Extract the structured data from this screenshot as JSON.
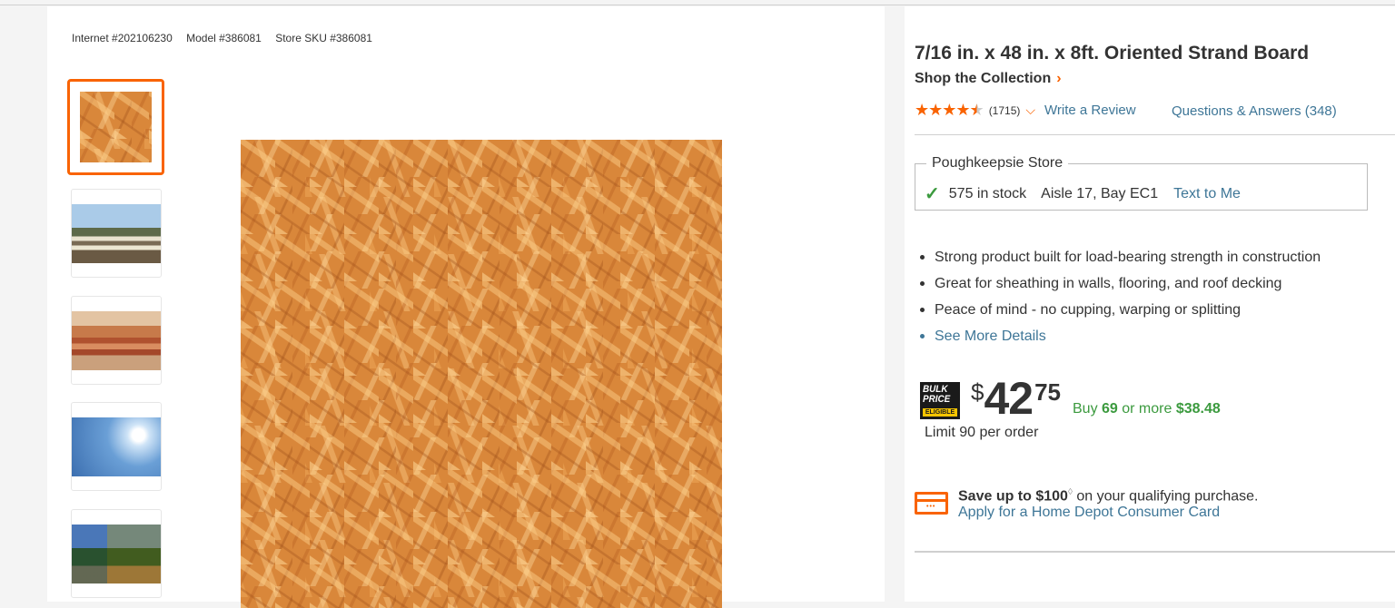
{
  "identifiers": {
    "internet": "Internet #202106230",
    "model": "Model #386081",
    "store_sku": "Store SKU #386081"
  },
  "thumbnails": [
    {
      "icon": "osb-board-image",
      "active": true
    },
    {
      "icon": "roof-construction-image",
      "active": false
    },
    {
      "icon": "board-stack-image",
      "active": false
    },
    {
      "icon": "workers-sky-image",
      "active": false
    },
    {
      "icon": "wall-sheathing-image",
      "active": false
    }
  ],
  "product": {
    "title": "7/16 in. x 48 in. x 8ft. Oriented Strand Board",
    "shop_collection": "Shop the Collection",
    "rating_value": 4.5,
    "review_count": "(1715)",
    "write_review": "Write a Review",
    "qa_link": "Questions & Answers (348)"
  },
  "store": {
    "name": "Poughkeepsie Store",
    "stock": "575 in stock",
    "aisle": "Aisle 17, Bay EC1",
    "text_to_me": "Text to Me"
  },
  "bullets": [
    "Strong product built for load-bearing strength in construction",
    "Great for sheathing in walls, flooring, and roof decking",
    "Peace of mind - no cupping, warping or splitting"
  ],
  "see_more": "See More Details",
  "bulk_badge": {
    "line1": "BULK",
    "line2": "PRICE",
    "line3": "ELIGIBLE"
  },
  "price": {
    "currency": "$",
    "dollars": "42",
    "cents": "75",
    "bulk_prefix": "Buy ",
    "bulk_qty": "69",
    "bulk_mid": " or more ",
    "bulk_price": "$38.48",
    "limit": "Limit 90 per order"
  },
  "credit": {
    "save_bold": "Save up to $100",
    "save_mark": "◊",
    "save_rest": " on your qualifying purchase.",
    "apply": "Apply for a Home Depot Consumer Card"
  },
  "colors": {
    "accent": "#f96302",
    "link": "#3e7697",
    "success": "#3b9a3e"
  }
}
